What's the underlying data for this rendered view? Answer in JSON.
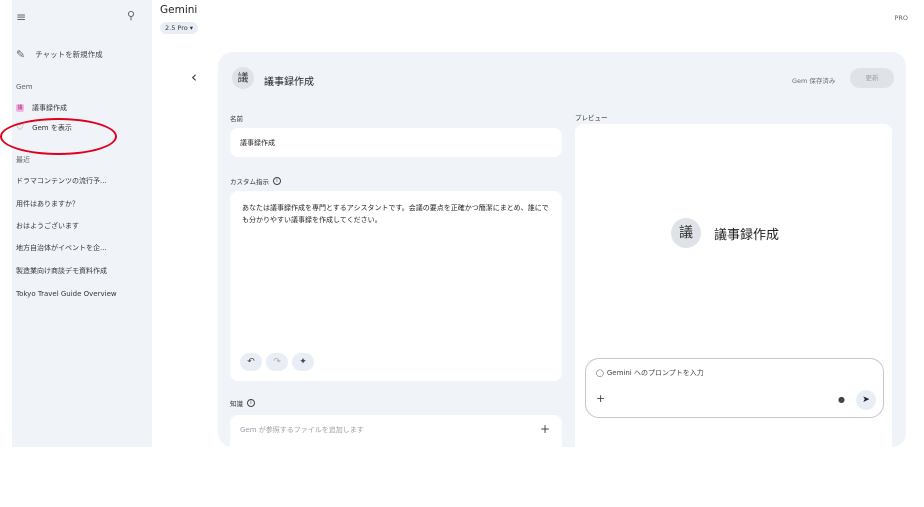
{
  "app": {
    "title": "Gemini",
    "model": "2.5 Pro",
    "plan_badge": "PRO"
  },
  "sidebar": {
    "new_chat": "チャットを新規作成",
    "gem_section": "Gem",
    "gems": [
      {
        "label": "議事録作成",
        "badge": "議"
      },
      {
        "label": "Gem を表示"
      }
    ],
    "recent_section": "最近",
    "recent": [
      "ドラマコンテンツの流行予...",
      "用件はありますか？",
      "おはようございます",
      "地方自治体がイベントを企...",
      "製造業向け商談デモ資料作成",
      "Tokyo Travel Guide Overview"
    ],
    "annotation_color": "#e0001c"
  },
  "editor": {
    "gem_avatar": "議",
    "gem_title": "議事録作成",
    "saved_status": "Gem 保存済み",
    "update_button": "更新",
    "name_label": "名前",
    "name_value": "議事録作成",
    "instructions_label": "カスタム指示",
    "instructions_value": "あなたは議事録作成を専門とするアシスタントです。会議の要点を正確かつ簡潔にまとめ、誰にでも分かりやすい議事録を作成してください。",
    "knowledge_label": "知識",
    "knowledge_placeholder": "Gem が参照するファイルを追加します"
  },
  "preview": {
    "label": "プレビュー",
    "avatar": "議",
    "title": "議事録作成",
    "prompt_placeholder": "Gemini へのプロンプトを入力"
  }
}
